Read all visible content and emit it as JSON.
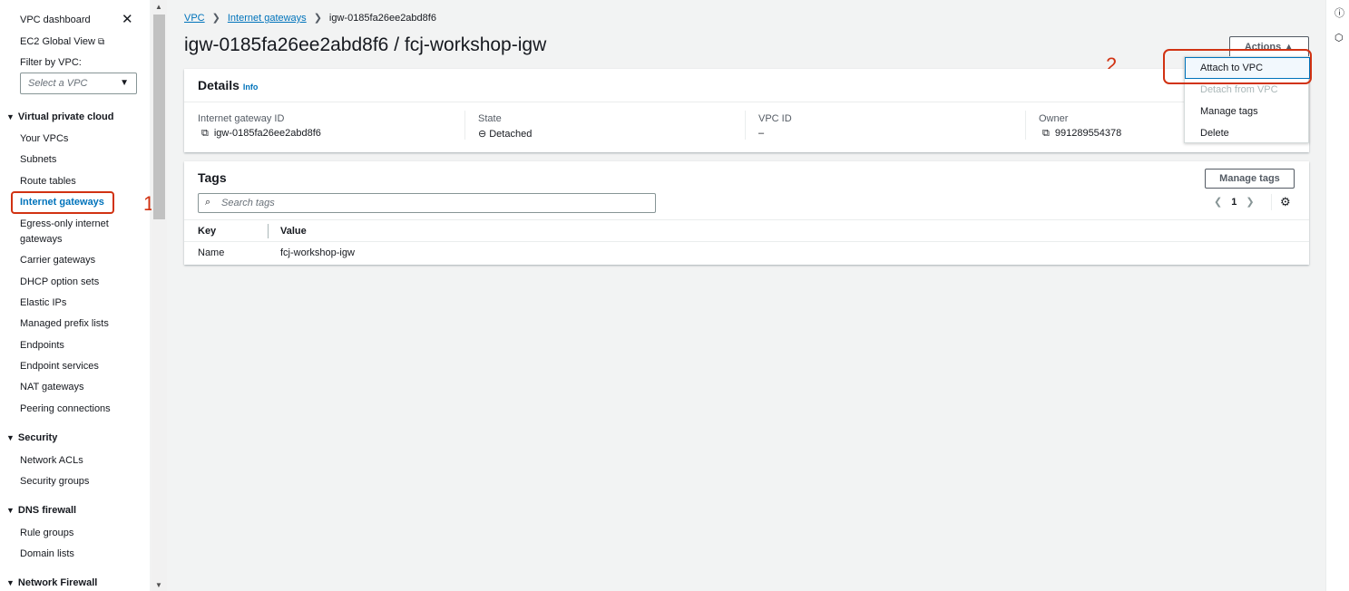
{
  "sidebar": {
    "dashboard": "VPC dashboard",
    "ec2_global": "EC2 Global View",
    "filter_label": "Filter by VPC:",
    "select_placeholder": "Select a VPC",
    "sections": {
      "vpc": "Virtual private cloud",
      "security": "Security",
      "dns": "DNS firewall",
      "network_firewall": "Network Firewall"
    },
    "items": {
      "your_vpcs": "Your VPCs",
      "subnets": "Subnets",
      "route_tables": "Route tables",
      "internet_gateways": "Internet gateways",
      "egress_1": "Egress-only internet",
      "egress_2": "gateways",
      "carrier": "Carrier gateways",
      "dhcp": "DHCP option sets",
      "elastic_ips": "Elastic IPs",
      "prefix_lists": "Managed prefix lists",
      "endpoints": "Endpoints",
      "endpoint_services": "Endpoint services",
      "nat": "NAT gateways",
      "peering": "Peering connections",
      "network_acls": "Network ACLs",
      "security_groups": "Security groups",
      "rule_groups": "Rule groups",
      "domain_lists": "Domain lists"
    }
  },
  "annotations": {
    "step1": "1",
    "step2": "2"
  },
  "breadcrumb": {
    "vpc": "VPC",
    "igw": "Internet gateways",
    "current": "igw-0185fa26ee2abd8f6"
  },
  "title": "igw-0185fa26ee2abd8f6 / fcj-workshop-igw",
  "actions": {
    "label": "Actions ▲",
    "menu": {
      "attach": "Attach to VPC",
      "detach": "Detach from VPC",
      "manage_tags": "Manage tags",
      "delete": "Delete"
    }
  },
  "details": {
    "header": "Details",
    "info": "Info",
    "igw_id_label": "Internet gateway ID",
    "igw_id": "igw-0185fa26ee2abd8f6",
    "state_label": "State",
    "state": "Detached",
    "vpc_id_label": "VPC ID",
    "vpc_id": "–",
    "owner_label": "Owner",
    "owner": "991289554378"
  },
  "tags": {
    "header": "Tags",
    "manage_button": "Manage tags",
    "search_placeholder": "Search tags",
    "page": "1",
    "columns": {
      "key": "Key",
      "value": "Value"
    },
    "rows": [
      {
        "key": "Name",
        "value": "fcj-workshop-igw"
      }
    ]
  },
  "colors": {
    "accent": "#0073bb",
    "annotation": "#d13212"
  }
}
